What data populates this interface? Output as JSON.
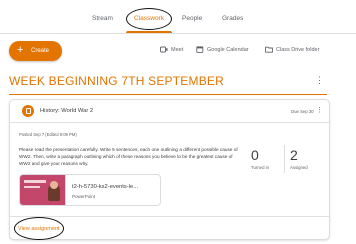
{
  "tabs": [
    {
      "label": "Stream"
    },
    {
      "label": "Classwork"
    },
    {
      "label": "People"
    },
    {
      "label": "Grades"
    }
  ],
  "toolbar": {
    "create_label": "Create",
    "meet_label": "Meet",
    "calendar_label": "Google Calendar",
    "drive_label": "Class Drive folder"
  },
  "topic": {
    "title": "WEEK BEGINNING 7TH SEPTEMBER"
  },
  "assignment": {
    "title": "History: World War 2",
    "due": "Due Sep 30",
    "posted": "Posted Sep 7 (Edited 9:09 PM)",
    "description": "Please read the presentation carefully. Write 5 sentences, each one outlining a different possible cause of WW2. Then, write a paragraph outlining which of these reasons you believe to be the greatest cause of WW2 and give your reasons why.",
    "turned_in_count": "0",
    "turned_in_label": "Turned in",
    "assigned_count": "2",
    "assigned_label": "Assigned",
    "attachment_name": "t2-h-5730-ks2-events-le...",
    "attachment_type": "PowerPoint",
    "view_label": "View assignment"
  },
  "colors": {
    "accent": "#e37400",
    "text": "#3c4043",
    "muted": "#5f6368",
    "border": "#dadce0"
  }
}
